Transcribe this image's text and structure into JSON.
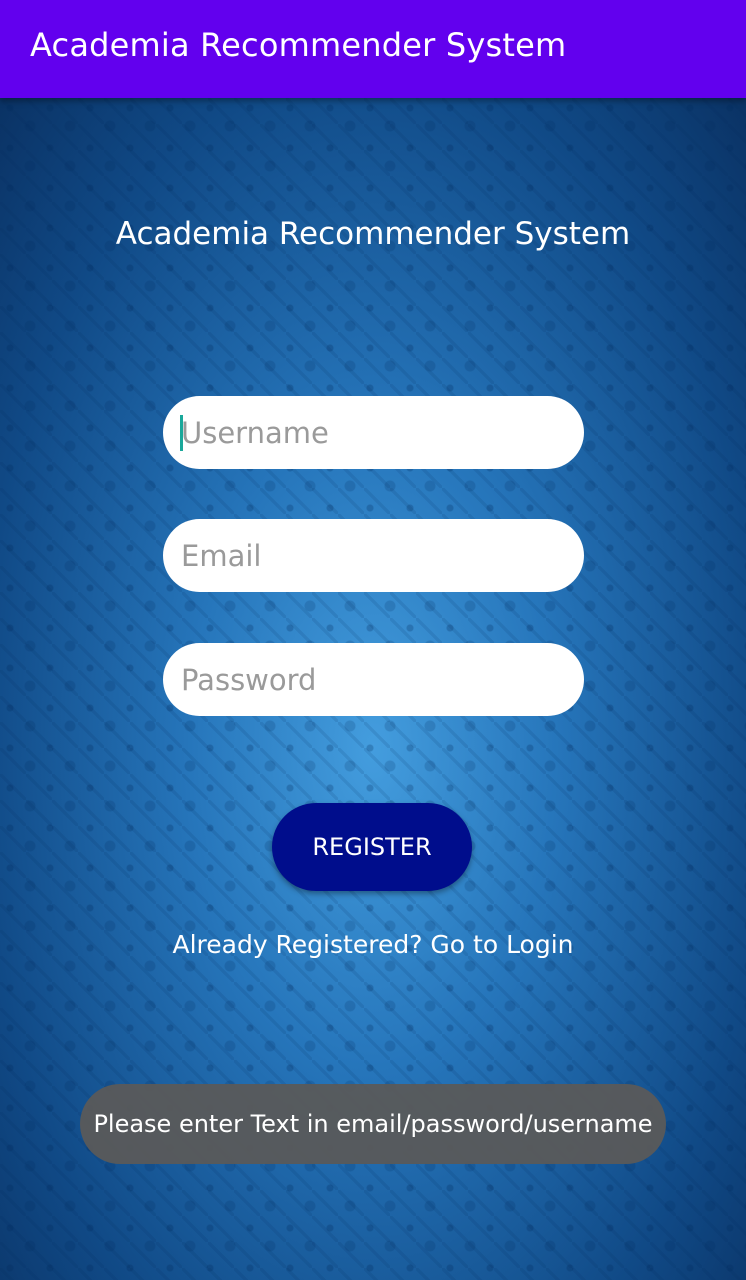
{
  "appbar": {
    "title": "Academia Recommender System"
  },
  "main": {
    "heading": "Academia Recommender System",
    "fields": {
      "username": {
        "value": "",
        "placeholder": "Username"
      },
      "email": {
        "value": "",
        "placeholder": "Email"
      },
      "password": {
        "value": "",
        "placeholder": "Password"
      }
    },
    "register_label": "REGISTER",
    "login_link": "Already Registered? Go to Login"
  },
  "toast": {
    "message": "Please enter Text in email/password/username"
  },
  "colors": {
    "appbar": "#6200ee",
    "register_button": "#000d8c",
    "background": "#1a67a8",
    "toast": "#5a5a5a"
  }
}
